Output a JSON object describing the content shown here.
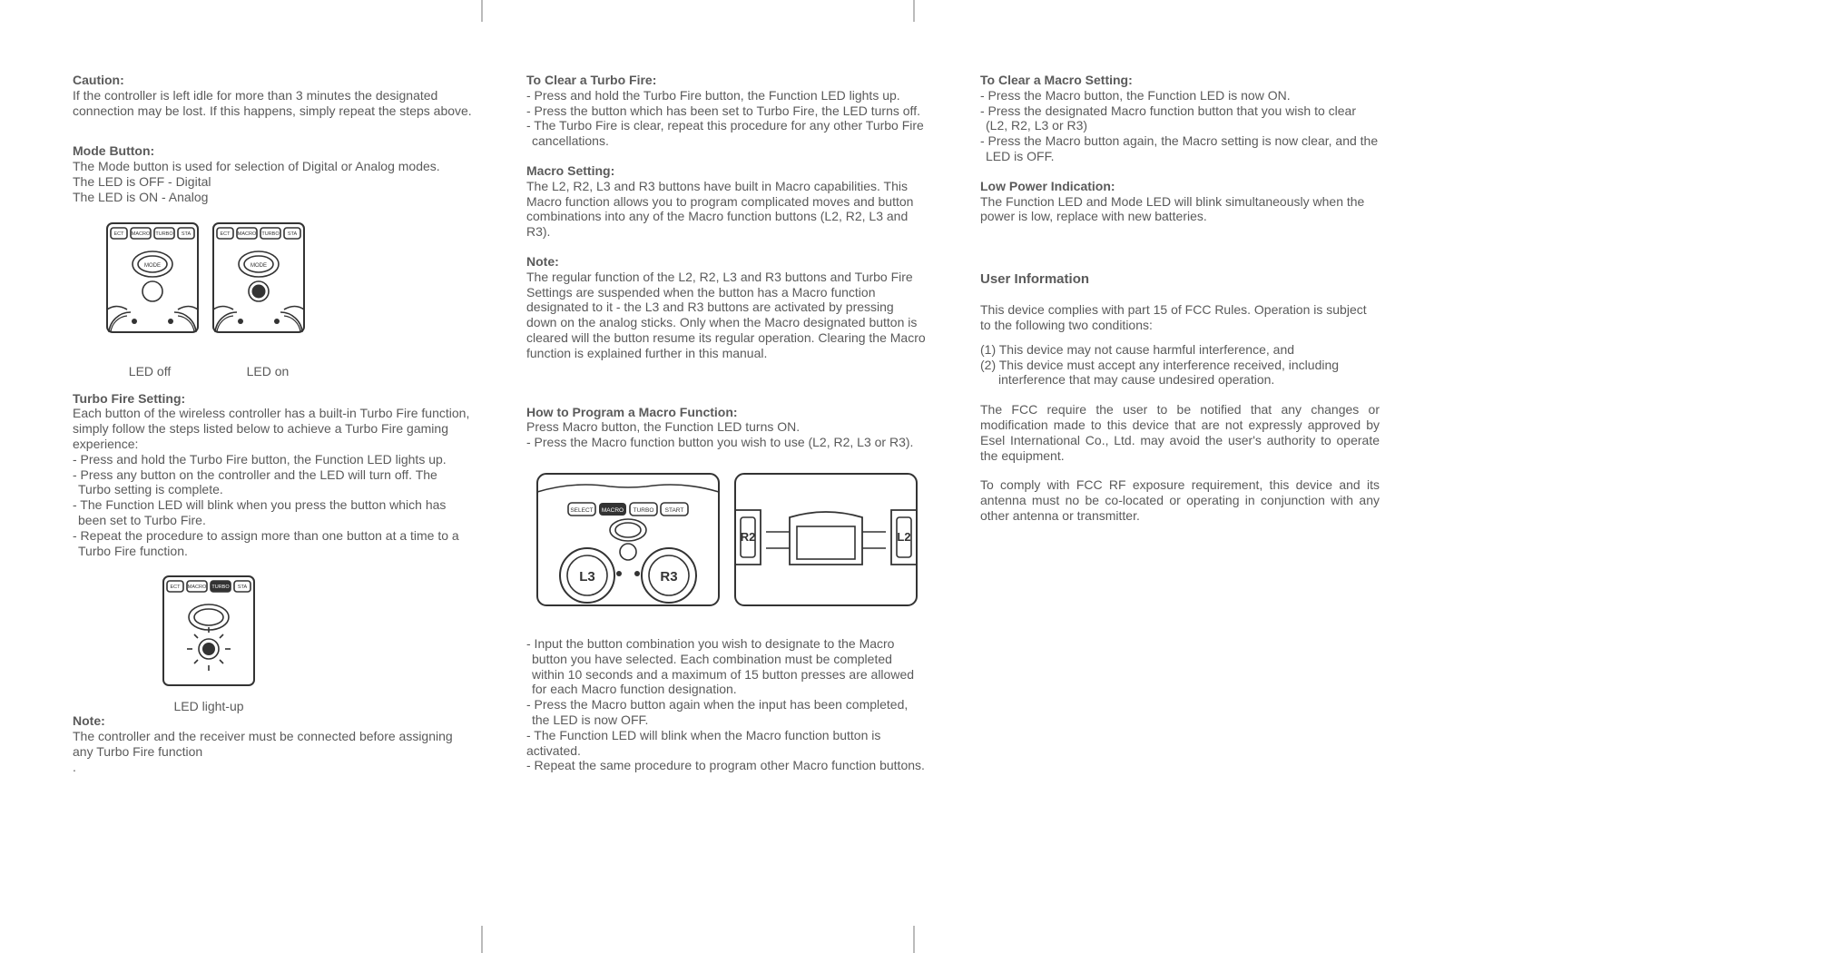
{
  "col1": {
    "caution_h": "Caution:",
    "caution_b": "If the controller is left idle for more than 3 minutes the designated connection may be lost. If this happens, simply repeat the steps above.",
    "mode_h": "Mode Button:",
    "mode_b1": "The Mode button is used for selection of Digital or Analog modes.",
    "mode_b2": "The LED is OFF - Digital",
    "mode_b3": "The LED is ON - Analog",
    "led_off": "LED off",
    "led_on": "LED on",
    "turbo_h": "Turbo Fire Setting:",
    "turbo_intro": "Each button of the wireless controller has a built-in Turbo Fire function, simply follow the steps listed below to achieve a Turbo Fire gaming experience:",
    "turbo_s1": "- Press and hold the Turbo Fire button, the Function LED lights up.",
    "turbo_s2": "- Press any button on the controller and the LED will turn off. The Turbo setting is complete.",
    "turbo_s3": "- The Function LED will blink when you press the button which has been set to Turbo Fire.",
    "turbo_s4": "- Repeat the procedure to assign more than one button at a time to a Turbo Fire function.",
    "led_lightup": "LED light-up",
    "note_h": "Note:",
    "note_b": "The controller and the receiver must be connected before assigning any Turbo Fire function",
    "period": "."
  },
  "col2": {
    "clear_h": "To Clear a Turbo Fire:",
    "clear_s1": "- Press and hold the Turbo Fire button, the Function LED lights up.",
    "clear_s2": "- Press the button which has been set to Turbo Fire, the LED turns off.",
    "clear_s3": "- The Turbo Fire is clear, repeat this procedure for any other Turbo Fire cancellations.",
    "macro_h": "Macro Setting:",
    "macro_b": "The L2, R2, L3 and R3 buttons have built in Macro capabilities.  This Macro function allows you to program complicated moves and button combinations into any of the Macro function buttons (L2, R2, L3 and R3).",
    "note_h": "Note:",
    "note_b": "The regular function of the L2, R2, L3 and R3 buttons and Turbo Fire Settings are suspended when the button has a Macro function designated to it - the L3 and R3 buttons are activated by pressing down on the analog sticks.  Only when the Macro designated button is cleared will the button resume its regular operation. Clearing the Macro function is explained further in this manual.",
    "prog_h": "How to Program a Macro Function:",
    "prog_b1": "Press Macro button, the Function LED turns ON.",
    "prog_b2": "- Press the Macro function button you wish to use (L2, R2, L3 or R3).",
    "prog_s1": "- Input the button combination you wish to designate to the Macro button you have selected.  Each combination must be completed within 10 seconds and a maximum of 15 button presses are allowed for each Macro function designation.",
    "prog_s2": "- Press the Macro button again when the input has been completed, the LED is now OFF.",
    "prog_s3": "- The Function LED will blink when the Macro function button is activated.",
    "prog_s4": "- Repeat the same procedure to program other Macro function buttons.",
    "btn_select": "SELECT",
    "btn_macro": "MACRO",
    "btn_turbo": "TURBO",
    "btn_start": "START",
    "btn_l3": "L3",
    "btn_r3": "R3",
    "btn_r2": "R2",
    "btn_l2": "L2"
  },
  "col3": {
    "clear_h": "To Clear a Macro Setting:",
    "clear_s1": "- Press the Macro button, the Function LED is now ON.",
    "clear_s2": "- Press the designated Macro function button that you wish to clear (L2, R2, L3 or R3)",
    "clear_s3": "- Press the Macro button again, the Macro setting is now clear, and the LED is OFF.",
    "low_h": "Low Power Indication:",
    "low_b": "The Function LED and Mode LED will blink simultaneously when the power is low, replace with new batteries.",
    "user_h": "User Information",
    "user_b1": "This device complies with part 15 of FCC Rules. Operation is subject to the following two conditions:",
    "user_b2": "(1) This device may not cause harmful interference, and",
    "user_b3": "(2) This device must accept any interference received, including interference that may cause undesired operation.",
    "user_b4": "The FCC require the user to be notified that any changes or modification made to this device that are not expressly approved by Esel International Co., Ltd. may avoid the user's authority to operate the equipment.",
    "user_b5": "To comply with FCC RF exposure requirement, this device and its antenna must no be co-located or operating in conjunction with any other antenna or transmitter."
  },
  "svg_labels": {
    "ect": "ECT",
    "macro": "MACRO",
    "turbo": "TURBO",
    "sta": "STA",
    "start": "START",
    "mode": "MODE"
  }
}
